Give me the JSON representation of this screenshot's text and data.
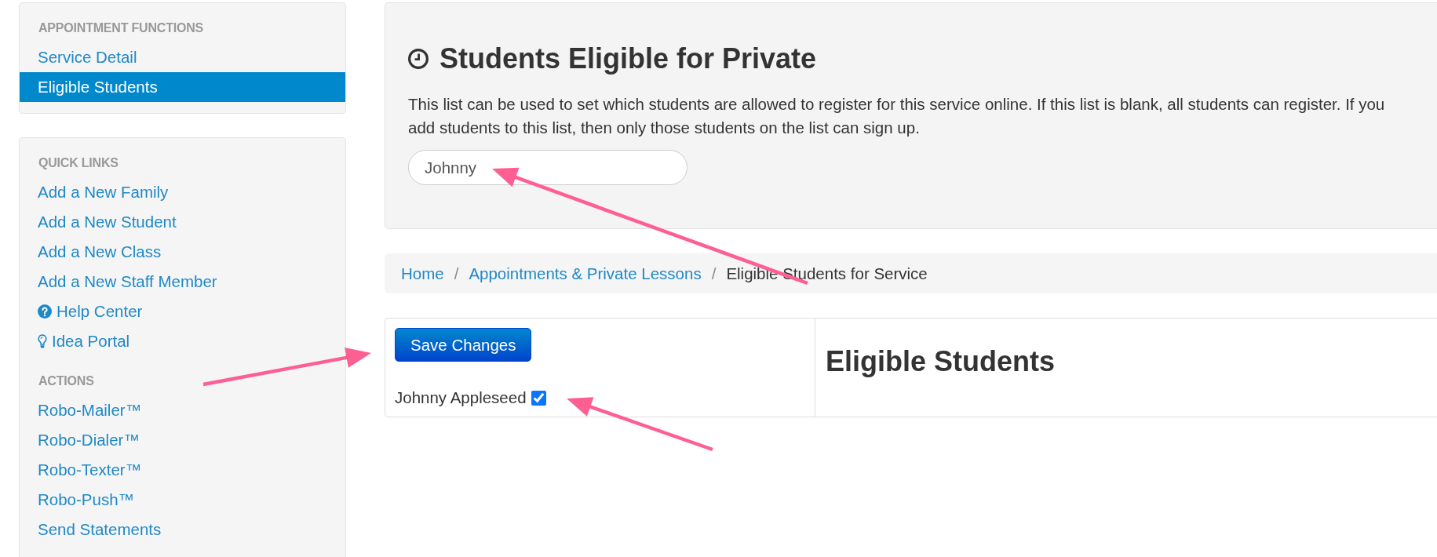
{
  "sidebar": {
    "panels": [
      {
        "groups": [
          {
            "heading": "APPOINTMENT FUNCTIONS",
            "items": [
              {
                "label": "Service Detail",
                "kind": "link",
                "selected": false
              },
              {
                "label": "Eligible Students",
                "kind": "link",
                "selected": true
              }
            ]
          }
        ]
      },
      {
        "groups": [
          {
            "heading": "QUICK LINKS",
            "items": [
              {
                "label": "Add a New Family",
                "kind": "link",
                "selected": false
              },
              {
                "label": "Add a New Student",
                "kind": "link",
                "selected": false
              },
              {
                "label": "Add a New Class",
                "kind": "link",
                "selected": false
              },
              {
                "label": "Add a New Staff Member",
                "kind": "link",
                "selected": false
              },
              {
                "label": "Help Center",
                "kind": "help",
                "selected": false
              },
              {
                "label": "Idea Portal",
                "kind": "idea",
                "selected": false
              }
            ]
          },
          {
            "heading": "ACTIONS",
            "items": [
              {
                "label": "Robo-Mailer™",
                "kind": "link",
                "selected": false
              },
              {
                "label": "Robo-Dialer™",
                "kind": "link",
                "selected": false
              },
              {
                "label": "Robo-Texter™",
                "kind": "link",
                "selected": false
              },
              {
                "label": "Robo-Push™",
                "kind": "link",
                "selected": false
              },
              {
                "label": "Send Statements",
                "kind": "link",
                "selected": false
              }
            ]
          }
        ]
      }
    ]
  },
  "main": {
    "header": {
      "title": "Students Eligible for Private",
      "description": "This list can be used to set which students are allowed to register for this service online. If this list is blank, all students can register. If you add students to this list, then only those students on the list can sign up.",
      "search": {
        "value": "Johnny"
      }
    },
    "breadcrumb": {
      "separator": "/",
      "items": [
        {
          "label": "Home",
          "active": false
        },
        {
          "label": "Appointments & Private Lessons",
          "active": false
        },
        {
          "label": "Eligible Students for Service",
          "active": true
        }
      ]
    },
    "form": {
      "save_button": "Save Changes",
      "students": [
        {
          "name": "Johnny Appleseed",
          "checked": true
        }
      ],
      "heading": "Eligible Students"
    }
  }
}
